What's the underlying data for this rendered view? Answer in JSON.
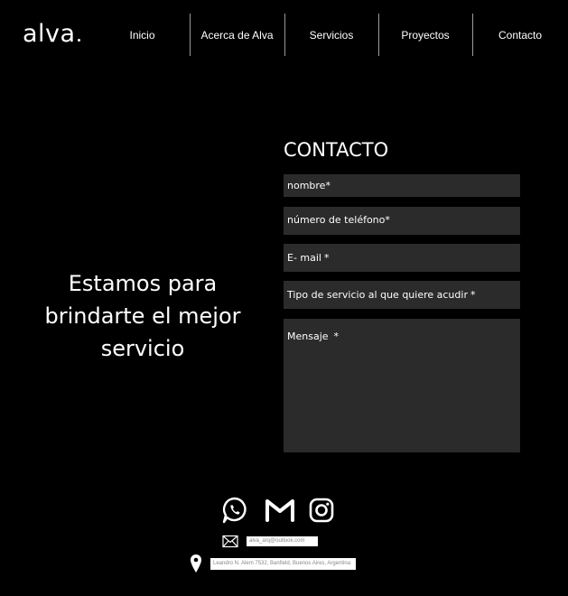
{
  "brand": {
    "logo_text": "alva"
  },
  "nav": {
    "items": [
      {
        "label": "Inicio"
      },
      {
        "label": "Acerca de Alva"
      },
      {
        "label": "Servicios"
      },
      {
        "label": "Proyectos"
      },
      {
        "label": "Contacto"
      }
    ]
  },
  "hero": {
    "line1": "Estamos para",
    "line2": "brindarte el mejor",
    "line3": "servicio"
  },
  "form": {
    "title": "CONTACTO",
    "fields": [
      {
        "label": "nombre",
        "required_mark": "*"
      },
      {
        "label": "número de teléfono",
        "required_mark": "*"
      },
      {
        "label": "E- mail",
        "required_mark": "*"
      },
      {
        "label": "Tipo de servicio al que quiere acudir",
        "required_mark": "*"
      },
      {
        "label": "Mensaje",
        "required_mark": "*"
      }
    ]
  },
  "footer": {
    "social_icons": [
      "whatsapp-icon",
      "gmail-icon",
      "instagram-icon"
    ],
    "email": "alva_arq@outlook.com",
    "address": "Leandro N. Alem 7532, Banfield, Buenos Aires, Argentina"
  },
  "colors": {
    "background": "#000000",
    "field_bg": "#2b2b2b",
    "text": "#ffffff",
    "separator": "#9a9a9a"
  }
}
